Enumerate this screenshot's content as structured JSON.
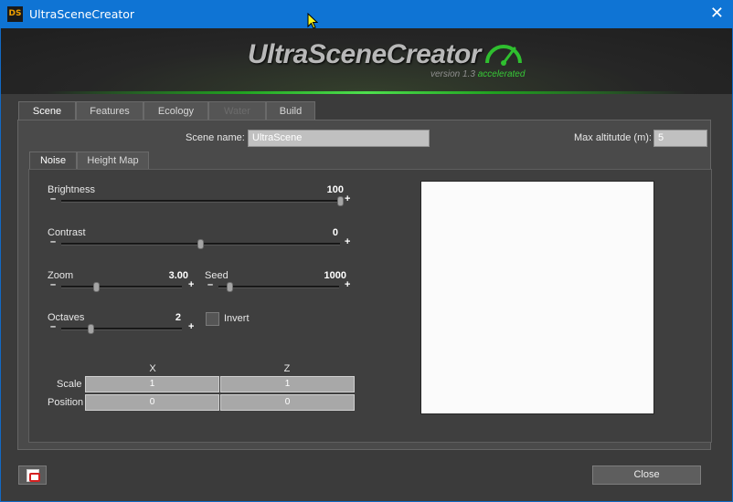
{
  "window": {
    "icon_text": "DS",
    "title": "UltraSceneCreator",
    "close_glyph": "✕"
  },
  "logo": {
    "name": "UltraSceneCreator",
    "version_prefix": "version 1.3",
    "version_suffix": "accelerated",
    "icon": "gauge-icon"
  },
  "tabs": [
    {
      "label": "Scene",
      "state": "active"
    },
    {
      "label": "Features",
      "state": "normal"
    },
    {
      "label": "Ecology",
      "state": "normal"
    },
    {
      "label": "Water",
      "state": "disabled"
    },
    {
      "label": "Build",
      "state": "normal"
    }
  ],
  "scene": {
    "name_label": "Scene name:",
    "name_value": "UltraScene",
    "max_alt_label": "Max altitutde (m):",
    "max_alt_value": "5"
  },
  "subtabs": [
    {
      "label": "Noise",
      "state": "active"
    },
    {
      "label": "Height Map",
      "state": "normal"
    }
  ],
  "noise": {
    "brightness": {
      "label": "Brightness",
      "value": "100",
      "fraction": 1.0
    },
    "contrast": {
      "label": "Contrast",
      "value": "0",
      "fraction": 0.5
    },
    "zoom": {
      "label": "Zoom",
      "value": "3.00",
      "fraction": 0.3
    },
    "seed": {
      "label": "Seed",
      "value": "1000",
      "fraction": 0.09
    },
    "octaves": {
      "label": "Octaves",
      "value": "2",
      "fraction": 0.25
    },
    "invert": {
      "label": "Invert",
      "checked": false
    },
    "slider_minus": "–",
    "slider_plus": "+"
  },
  "transform": {
    "col_x": "X",
    "col_z": "Z",
    "scale_label": "Scale",
    "scale_x": "1",
    "scale_z": "1",
    "position_label": "Position",
    "position_x": "0",
    "position_z": "0"
  },
  "footer": {
    "pdf_icon": "pdf-icon",
    "close_label": "Close"
  },
  "colors": {
    "titlebar": "#0f74d4",
    "accent_green": "#37c837",
    "background": "#3b3b3b"
  }
}
